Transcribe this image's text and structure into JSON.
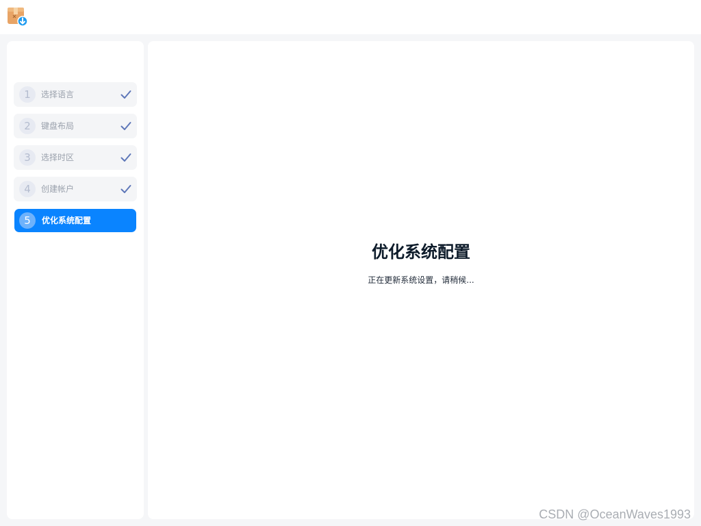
{
  "sidebar": {
    "steps": [
      {
        "number": "1",
        "label": "选择语言",
        "status": "done",
        "icon": "check-icon"
      },
      {
        "number": "2",
        "label": "键盘布局",
        "status": "done",
        "icon": "check-icon"
      },
      {
        "number": "3",
        "label": "选择时区",
        "status": "done",
        "icon": "check-icon"
      },
      {
        "number": "4",
        "label": "创建帐户",
        "status": "done",
        "icon": "check-icon"
      },
      {
        "number": "5",
        "label": "优化系统配置",
        "status": "current"
      }
    ]
  },
  "main": {
    "title": "优化系统配置",
    "subtitle": "正在更新系统设置，请稍候..."
  },
  "watermark": "CSDN @OceanWaves1993",
  "colors": {
    "accent": "#0a84ff",
    "check": "#5e77b8",
    "step_bg": "#f4f5f7",
    "title": "#0d1b2a"
  },
  "icons": {
    "app": "installer-box-download-icon"
  }
}
